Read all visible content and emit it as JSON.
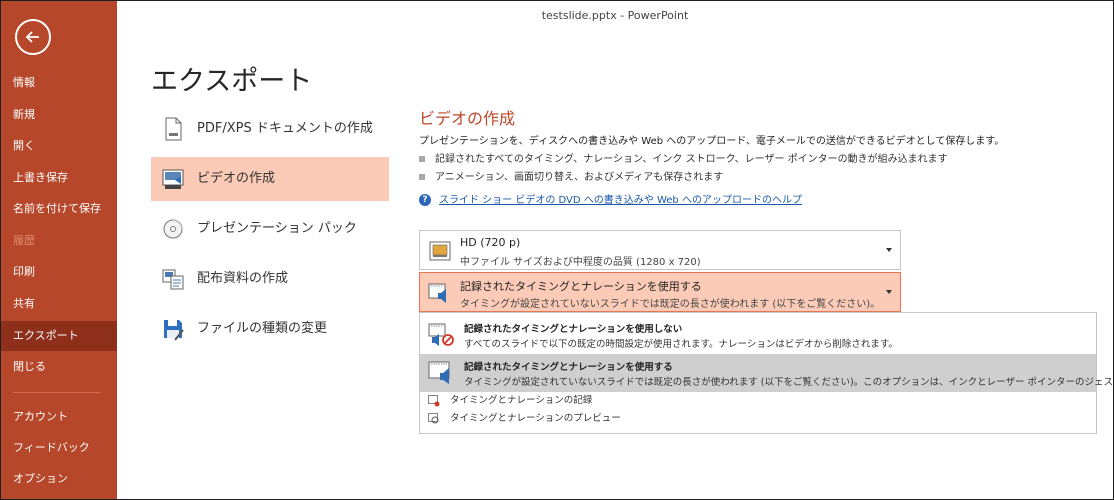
{
  "window": {
    "title": "testslide.pptx  -  PowerPoint"
  },
  "nav": {
    "items": [
      {
        "label": "情報",
        "state": "normal"
      },
      {
        "label": "新規",
        "state": "normal"
      },
      {
        "label": "開く",
        "state": "normal"
      },
      {
        "label": "上書き保存",
        "state": "normal"
      },
      {
        "label": "名前を付けて保存",
        "state": "normal"
      },
      {
        "label": "履歴",
        "state": "disabled"
      },
      {
        "label": "印刷",
        "state": "normal"
      },
      {
        "label": "共有",
        "state": "normal"
      },
      {
        "label": "エクスポート",
        "state": "active"
      },
      {
        "label": "閉じる",
        "state": "normal"
      },
      {
        "label": "アカウント",
        "state": "normal"
      },
      {
        "label": "フィードバック",
        "state": "normal"
      },
      {
        "label": "オプション",
        "state": "normal"
      }
    ]
  },
  "page": {
    "title": "エクスポート"
  },
  "export_options": [
    {
      "label": "PDF/XPS ドキュメントの作成",
      "icon": "pdf-document-icon",
      "selected": false
    },
    {
      "label": "ビデオの作成",
      "icon": "video-icon",
      "selected": true
    },
    {
      "label": "プレゼンテーション パック",
      "icon": "cd-package-icon",
      "selected": false
    },
    {
      "label": "配布資料の作成",
      "icon": "handout-icon",
      "selected": false
    },
    {
      "label": "ファイルの種類の変更",
      "icon": "file-type-save-icon",
      "selected": false
    }
  ],
  "video": {
    "title": "ビデオの作成",
    "description": "プレゼンテーションを、ディスクへの書き込みや Web へのアップロード、電子メールでの送信ができるビデオとして保存します。",
    "bullets": [
      "記録されたすべてのタイミング、ナレーション、インク ストローク、レーザー ポインターの動きが組み込まれます",
      "アニメーション、画面切り替え、およびメディアも保存されます"
    ],
    "help_link": "スライド ショー ビデオの DVD への書き込みや Web へのアップロードのヘルプ",
    "quality": {
      "title": "HD (720 p)",
      "subtitle": "中ファイル サイズおよび中程度の品質 (1280 x 720)"
    },
    "timing": {
      "title": "記録されたタイミングとナレーションを使用する",
      "subtitle": "タイミングが設定されていないスライドでは既定の長さが使われます (以下をご覧ください)。このオプ…"
    },
    "timing_menu": {
      "options": [
        {
          "title": "記録されたタイミングとナレーションを使用しない",
          "subtitle": "すべてのスライドで以下の既定の時間設定が使用されます。ナレーションはビデオから削除されます。",
          "selected": false
        },
        {
          "title": "記録されたタイミングとナレーションを使用する",
          "subtitle": "タイミングが設定されていないスライドでは既定の長さが使われます (以下をご覧ください)。このオプションは、インクとレーザー ポインターのジェスチャにも適用されます。",
          "selected": true
        }
      ],
      "actions": [
        {
          "label": "タイミングとナレーションの記録",
          "icon": "record-icon"
        },
        {
          "label": "タイミングとナレーションのプレビュー",
          "icon": "preview-icon"
        }
      ]
    }
  },
  "colors": {
    "nav_bg": "#b7472a",
    "nav_active": "#8e2f1c",
    "accent": "#c0472b",
    "selected_bg": "#fbcbb8"
  }
}
